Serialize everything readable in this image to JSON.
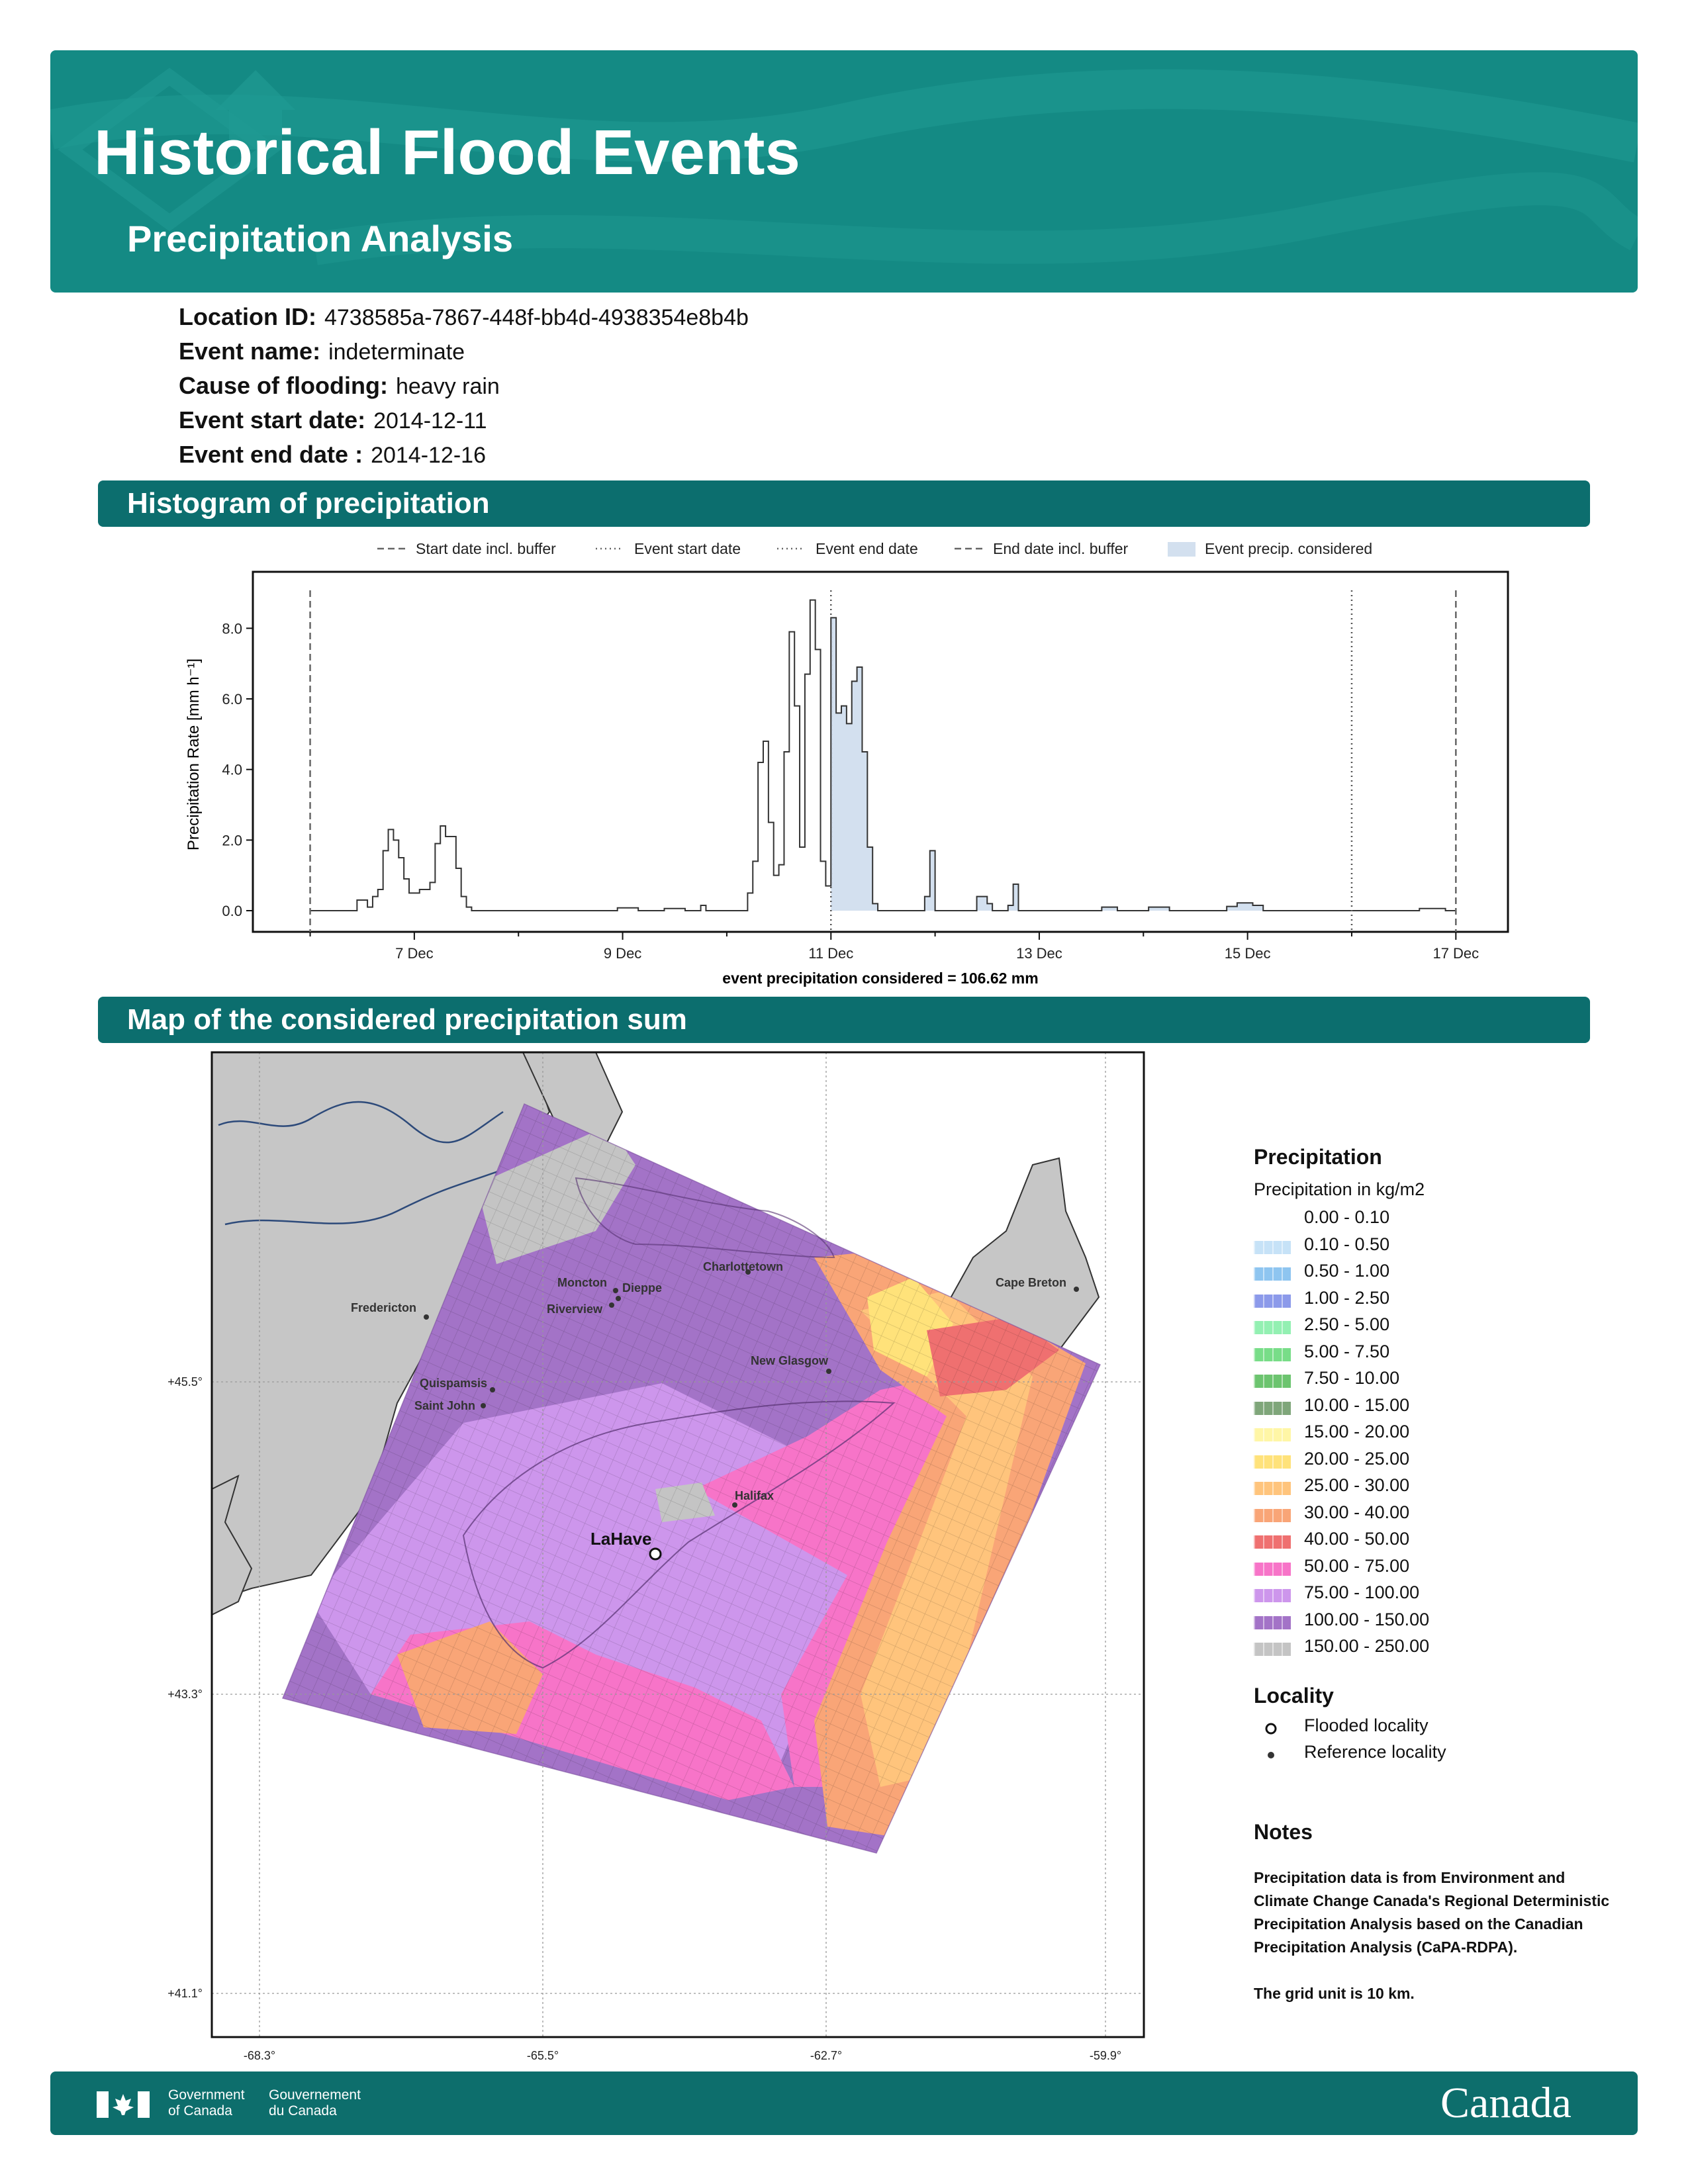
{
  "header": {
    "title": "Historical Flood Events",
    "subtitle": "Precipitation Analysis"
  },
  "info": [
    {
      "label": "Location ID:",
      "value": "4738585a-7867-448f-bb4d-4938354e8b4b"
    },
    {
      "label": "Event name:",
      "value": "indeterminate"
    },
    {
      "label": "Cause of flooding:",
      "value": "heavy rain"
    },
    {
      "label": "Event start date:",
      "value": "2014-12-11"
    },
    {
      "label": "Event end date :",
      "value": "2014-12-16"
    }
  ],
  "sections": {
    "histogram": "Histogram of precipitation",
    "map": "Map of the considered precipitation sum"
  },
  "colors": {
    "brand_teal": "#148a84",
    "section_teal": "#0c6e6e",
    "fill": "#d3e0ef",
    "flooded": "#ffffff"
  },
  "chart_data": [
    {
      "type": "area",
      "ylabel": "Precipitation Rate [mm h⁻¹]",
      "xlabel": "event precipitation considered = 106.62 mm",
      "ylim": [
        -0.6,
        9.6
      ],
      "yticks": [
        "0.0",
        "2.0",
        "4.0",
        "6.0",
        "8.0"
      ],
      "ytick_values": [
        0,
        2,
        4,
        6,
        8
      ],
      "xticks": [
        "7 Dec",
        "9 Dec",
        "11 Dec",
        "13 Dec",
        "15 Dec",
        "17 Dec"
      ],
      "xtick_days": [
        7,
        9,
        11,
        13,
        15,
        17
      ],
      "xlim_days": [
        5.45,
        17.5
      ],
      "grid": false,
      "legend": {
        "placement": "top",
        "entries": [
          "Start date incl. buffer",
          "Event start date",
          "Event end date",
          "End date incl. buffer",
          "Event precip. considered"
        ]
      },
      "vlines_days": {
        "start_buffer": 6.0,
        "event_start": 11.0,
        "event_end": 16.0,
        "end_buffer": 17.0
      },
      "shade_days": [
        11.0,
        16.0
      ],
      "series": [
        {
          "points": [
            [
              6.0,
              0
            ],
            [
              6.45,
              0
            ],
            [
              6.45,
              0.3
            ],
            [
              6.55,
              0.3
            ],
            [
              6.55,
              0.1
            ],
            [
              6.6,
              0.1
            ],
            [
              6.6,
              0.4
            ],
            [
              6.65,
              0.4
            ],
            [
              6.65,
              0.6
            ],
            [
              6.7,
              0.6
            ],
            [
              6.7,
              1.7
            ],
            [
              6.75,
              1.7
            ],
            [
              6.75,
              2.3
            ],
            [
              6.8,
              2.3
            ],
            [
              6.8,
              2.0
            ],
            [
              6.85,
              2.0
            ],
            [
              6.85,
              1.5
            ],
            [
              6.9,
              1.5
            ],
            [
              6.9,
              0.9
            ],
            [
              6.95,
              0.9
            ],
            [
              6.95,
              0.5
            ],
            [
              7.05,
              0.5
            ],
            [
              7.05,
              0.6
            ],
            [
              7.15,
              0.6
            ],
            [
              7.15,
              0.8
            ],
            [
              7.2,
              0.8
            ],
            [
              7.2,
              1.9
            ],
            [
              7.25,
              1.9
            ],
            [
              7.25,
              2.4
            ],
            [
              7.3,
              2.4
            ],
            [
              7.3,
              2.1
            ],
            [
              7.4,
              2.1
            ],
            [
              7.4,
              1.2
            ],
            [
              7.45,
              1.2
            ],
            [
              7.45,
              0.4
            ],
            [
              7.5,
              0.4
            ],
            [
              7.5,
              0.1
            ],
            [
              7.55,
              0.1
            ],
            [
              7.55,
              0
            ],
            [
              8.95,
              0
            ],
            [
              8.95,
              0.08
            ],
            [
              9.15,
              0.08
            ],
            [
              9.15,
              0
            ],
            [
              9.4,
              0
            ],
            [
              9.4,
              0.06
            ],
            [
              9.6,
              0.06
            ],
            [
              9.6,
              0
            ],
            [
              9.75,
              0
            ],
            [
              9.75,
              0.15
            ],
            [
              9.8,
              0.15
            ],
            [
              9.8,
              0
            ],
            [
              10.2,
              0
            ],
            [
              10.2,
              0.5
            ],
            [
              10.25,
              0.5
            ],
            [
              10.25,
              1.4
            ],
            [
              10.3,
              1.4
            ],
            [
              10.3,
              4.2
            ],
            [
              10.35,
              4.2
            ],
            [
              10.35,
              4.8
            ],
            [
              10.4,
              4.8
            ],
            [
              10.4,
              2.5
            ],
            [
              10.45,
              2.5
            ],
            [
              10.45,
              1.0
            ],
            [
              10.5,
              1.0
            ],
            [
              10.5,
              1.3
            ],
            [
              10.55,
              1.3
            ],
            [
              10.55,
              4.5
            ],
            [
              10.6,
              4.5
            ],
            [
              10.6,
              7.9
            ],
            [
              10.65,
              7.9
            ],
            [
              10.65,
              5.8
            ],
            [
              10.7,
              5.8
            ],
            [
              10.7,
              1.8
            ],
            [
              10.75,
              1.8
            ],
            [
              10.75,
              6.7
            ],
            [
              10.8,
              6.7
            ],
            [
              10.8,
              8.8
            ],
            [
              10.85,
              8.8
            ],
            [
              10.85,
              7.4
            ],
            [
              10.9,
              7.4
            ],
            [
              10.9,
              1.4
            ],
            [
              10.95,
              1.4
            ],
            [
              10.95,
              0.7
            ],
            [
              11.0,
              0.7
            ],
            [
              11.0,
              8.3
            ],
            [
              11.05,
              8.3
            ],
            [
              11.05,
              5.6
            ],
            [
              11.1,
              5.6
            ],
            [
              11.1,
              5.8
            ],
            [
              11.15,
              5.8
            ],
            [
              11.15,
              5.3
            ],
            [
              11.2,
              5.3
            ],
            [
              11.2,
              6.5
            ],
            [
              11.25,
              6.5
            ],
            [
              11.25,
              6.9
            ],
            [
              11.3,
              6.9
            ],
            [
              11.3,
              4.5
            ],
            [
              11.35,
              4.5
            ],
            [
              11.35,
              1.8
            ],
            [
              11.4,
              1.8
            ],
            [
              11.4,
              0.2
            ],
            [
              11.45,
              0.2
            ],
            [
              11.45,
              0
            ],
            [
              11.9,
              0
            ],
            [
              11.9,
              0.4
            ],
            [
              11.95,
              0.4
            ],
            [
              11.95,
              1.7
            ],
            [
              12.0,
              1.7
            ],
            [
              12.0,
              0
            ],
            [
              12.4,
              0
            ],
            [
              12.4,
              0.4
            ],
            [
              12.5,
              0.4
            ],
            [
              12.5,
              0.2
            ],
            [
              12.55,
              0.2
            ],
            [
              12.55,
              0
            ],
            [
              12.7,
              0
            ],
            [
              12.7,
              0.15
            ],
            [
              12.75,
              0.15
            ],
            [
              12.75,
              0.75
            ],
            [
              12.8,
              0.75
            ],
            [
              12.8,
              0
            ],
            [
              13.6,
              0
            ],
            [
              13.6,
              0.1
            ],
            [
              13.75,
              0.1
            ],
            [
              13.75,
              0
            ],
            [
              14.05,
              0
            ],
            [
              14.05,
              0.1
            ],
            [
              14.25,
              0.1
            ],
            [
              14.25,
              0
            ],
            [
              14.8,
              0
            ],
            [
              14.8,
              0.12
            ],
            [
              14.9,
              0.12
            ],
            [
              14.9,
              0.22
            ],
            [
              15.05,
              0.22
            ],
            [
              15.05,
              0.15
            ],
            [
              15.15,
              0.15
            ],
            [
              15.15,
              0
            ],
            [
              16.65,
              0
            ],
            [
              16.65,
              0.06
            ],
            [
              16.9,
              0.06
            ],
            [
              16.9,
              0
            ],
            [
              17.0,
              0
            ]
          ]
        }
      ]
    },
    {
      "type": "heatmap",
      "lon_ticks": [
        "-68.3°",
        "-65.5°",
        "-62.7°",
        "-59.9°"
      ],
      "lat_ticks": [
        "+45.5°",
        "+43.3°",
        "+41.1°"
      ],
      "legend": {
        "placement": "right",
        "title": "Precipitation",
        "subtitle": "Precipitation in kg/m2",
        "bins": [
          {
            "label": "0.00 - 0.10",
            "color": "#ffffff"
          },
          {
            "label": "0.10 - 0.50",
            "color": "#c6e2f7"
          },
          {
            "label": "0.50 - 1.00",
            "color": "#8ec5f0"
          },
          {
            "label": "1.00 - 2.50",
            "color": "#8c9aea"
          },
          {
            "label": "2.50 - 5.00",
            "color": "#93f0b2"
          },
          {
            "label": "5.00 - 7.50",
            "color": "#78dd88"
          },
          {
            "label": "7.50 - 10.00",
            "color": "#6cc46f"
          },
          {
            "label": "10.00 - 15.00",
            "color": "#7fa67a"
          },
          {
            "label": "15.00 - 20.00",
            "color": "#fff6a6"
          },
          {
            "label": "20.00 - 25.00",
            "color": "#ffe27a"
          },
          {
            "label": "25.00 - 30.00",
            "color": "#ffc47c"
          },
          {
            "label": "30.00 - 40.00",
            "color": "#f9a577"
          },
          {
            "label": "40.00 - 50.00",
            "color": "#ef7070"
          },
          {
            "label": "50.00 - 75.00",
            "color": "#f774c8"
          },
          {
            "label": "75.00 - 100.00",
            "color": "#cd96ec"
          },
          {
            "label": "100.00 - 150.00",
            "color": "#a373c7"
          },
          {
            "label": "150.00 - 250.00",
            "color": "#c4c4c4"
          }
        ]
      },
      "locality_legend": {
        "title": "Locality",
        "flooded": "Flooded locality",
        "reference": "Reference locality"
      },
      "places": {
        "flooded": [
          "LaHave"
        ],
        "reference": [
          "Fredericton",
          "Moncton",
          "Dieppe",
          "Riverview",
          "Charlottetown",
          "Cape Breton",
          "New Glasgow",
          "Quispamsis",
          "Saint John",
          "Halifax"
        ]
      }
    }
  ],
  "notes": {
    "title": "Notes",
    "text": "Precipitation data is from Environment and Climate Change Canada's Regional Deterministic Precipitation Analysis based on the Canadian Precipitation Analysis (CaPA-RDPA).",
    "grid": "The grid unit is 10 km."
  },
  "footer": {
    "gov_en_1": "Government",
    "gov_en_2": "of Canada",
    "gov_fr_1": "Gouvernement",
    "gov_fr_2": "du Canada",
    "wordmark": "Canada"
  }
}
